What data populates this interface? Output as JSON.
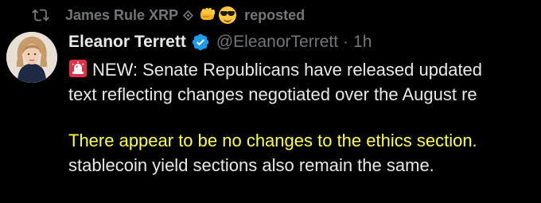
{
  "repost": {
    "user_name": "James Rule XRP",
    "label": "reposted",
    "icons": [
      "repost-icon",
      "diamond-icon",
      "fist-emoji",
      "sunglasses-emoji"
    ]
  },
  "author": {
    "display_name": "Eleanor Terrett",
    "handle": "@EleanorTerrett",
    "separator": "·",
    "time": "1h",
    "verified": true,
    "verified_color": "#1d9bf0"
  },
  "tweet": {
    "prefix_icon": "siren-icon",
    "line1": "NEW: Senate Republicans have released updated",
    "line2": "text reflecting changes negotiated over the August re",
    "highlight_line": "There appear to be no changes to the ethics section.",
    "line4": "stablecoin yield sections also remain the same."
  },
  "colors": {
    "background": "#000000",
    "primary_text": "#e7e9ea",
    "secondary_text": "#71767b",
    "highlight_text": "#ffff3d"
  }
}
